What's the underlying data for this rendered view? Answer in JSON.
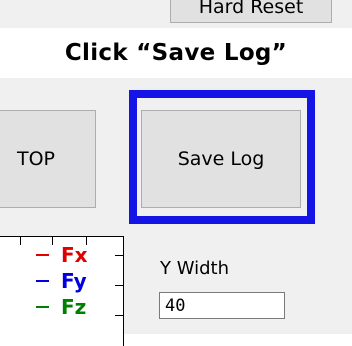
{
  "instruction": "Click “Save Log”",
  "buttons": {
    "hard_reset": "Hard Reset",
    "stop": "TOP",
    "save_log": "Save Log"
  },
  "legend": [
    {
      "label": "Fx",
      "color": "#e00000"
    },
    {
      "label": "Fy",
      "color": "#0000e0"
    },
    {
      "label": "Fz",
      "color": "#008000"
    }
  ],
  "y_width": {
    "label": "Y Width",
    "value": "40"
  },
  "colors": {
    "highlight": "#1414e6"
  }
}
